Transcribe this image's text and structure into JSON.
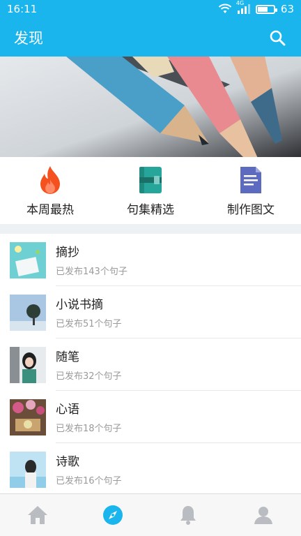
{
  "status_bar": {
    "time": "16:11",
    "network": "4G",
    "battery": "63",
    "battery_level": 0.63
  },
  "app_bar": {
    "title": "发现"
  },
  "quick_actions": [
    {
      "label": "本周最热",
      "icon": "flame-icon"
    },
    {
      "label": "句集精选",
      "icon": "book-icon"
    },
    {
      "label": "制作图文",
      "icon": "document-icon"
    }
  ],
  "list": [
    {
      "title": "摘抄",
      "subtitle": "已发布143个句子"
    },
    {
      "title": "小说书摘",
      "subtitle": "已发布51个句子"
    },
    {
      "title": "随笔",
      "subtitle": "已发布32个句子"
    },
    {
      "title": "心语",
      "subtitle": "已发布18个句子"
    },
    {
      "title": "诗歌",
      "subtitle": "已发布16个句子"
    }
  ],
  "tabs": [
    {
      "name": "home-icon"
    },
    {
      "name": "compass-icon",
      "active": true
    },
    {
      "name": "bell-icon"
    },
    {
      "name": "user-icon"
    }
  ],
  "colors": {
    "primary": "#19b5ec",
    "inactive_tab": "#b9bcc0",
    "flame": "#f4511e",
    "book": "#26a69a",
    "document": "#5c6bc0"
  }
}
